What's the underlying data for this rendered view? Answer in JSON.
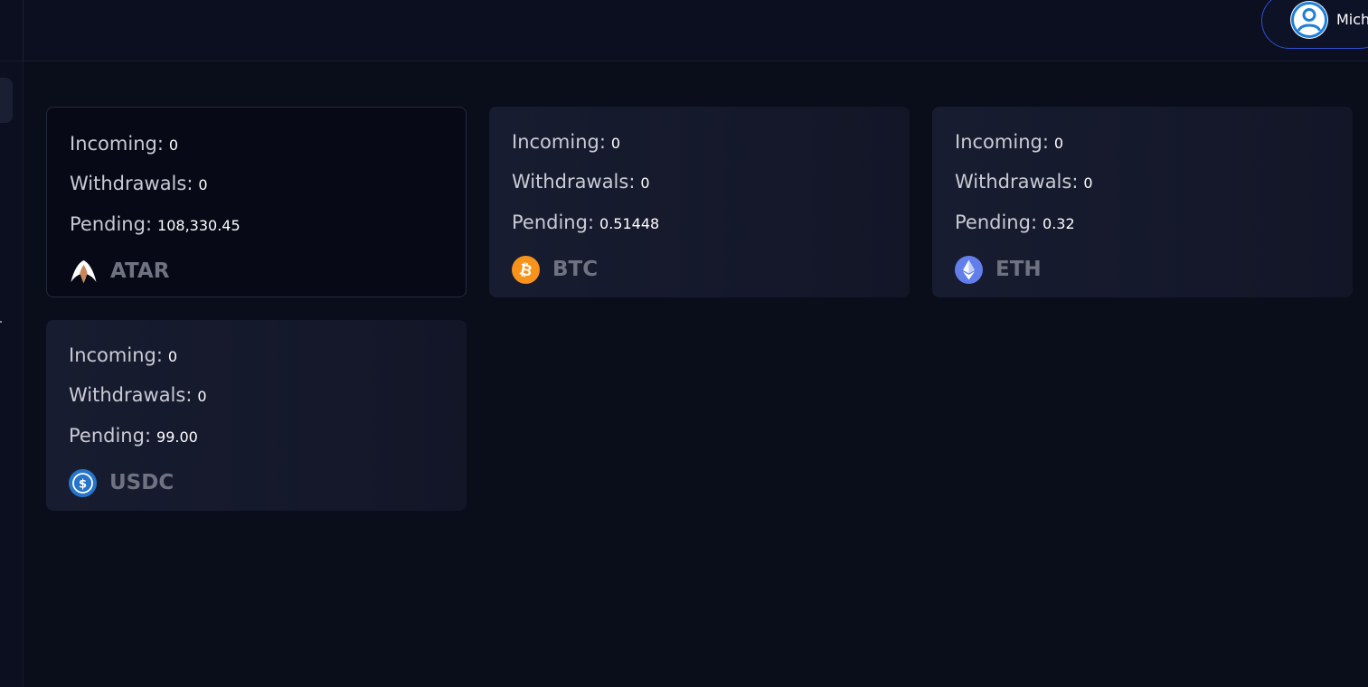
{
  "header": {
    "user": {
      "name": "Mich",
      "avatar_icon": "user-avatar-icon"
    }
  },
  "assets": [
    {
      "symbol": "ATAR",
      "icon": "atar-logo-icon",
      "incoming_label": "Incoming:",
      "incoming": "0",
      "withdrawals_label": "Withdrawals:",
      "withdrawals": "0",
      "pending_label": "Pending:",
      "pending": "108,330.45"
    },
    {
      "symbol": "BTC",
      "icon": "bitcoin-icon",
      "incoming_label": "Incoming:",
      "incoming": "0",
      "withdrawals_label": "Withdrawals:",
      "withdrawals": "0",
      "pending_label": "Pending:",
      "pending": "0.51448"
    },
    {
      "symbol": "ETH",
      "icon": "ethereum-icon",
      "incoming_label": "Incoming:",
      "incoming": "0",
      "withdrawals_label": "Withdrawals:",
      "withdrawals": "0",
      "pending_label": "Pending:",
      "pending": "0.32"
    },
    {
      "symbol": "USDC",
      "icon": "usdc-icon",
      "incoming_label": "Incoming:",
      "incoming": "0",
      "withdrawals_label": "Withdrawals:",
      "withdrawals": "0",
      "pending_label": "Pending:",
      "pending": "99.00"
    }
  ],
  "colors": {
    "background": "#0a0d1a",
    "card": "#181c30",
    "accent_blue": "#2f4fd6",
    "bitcoin": "#f7931a",
    "ethereum": "#627eea",
    "usdc": "#2775ca"
  }
}
